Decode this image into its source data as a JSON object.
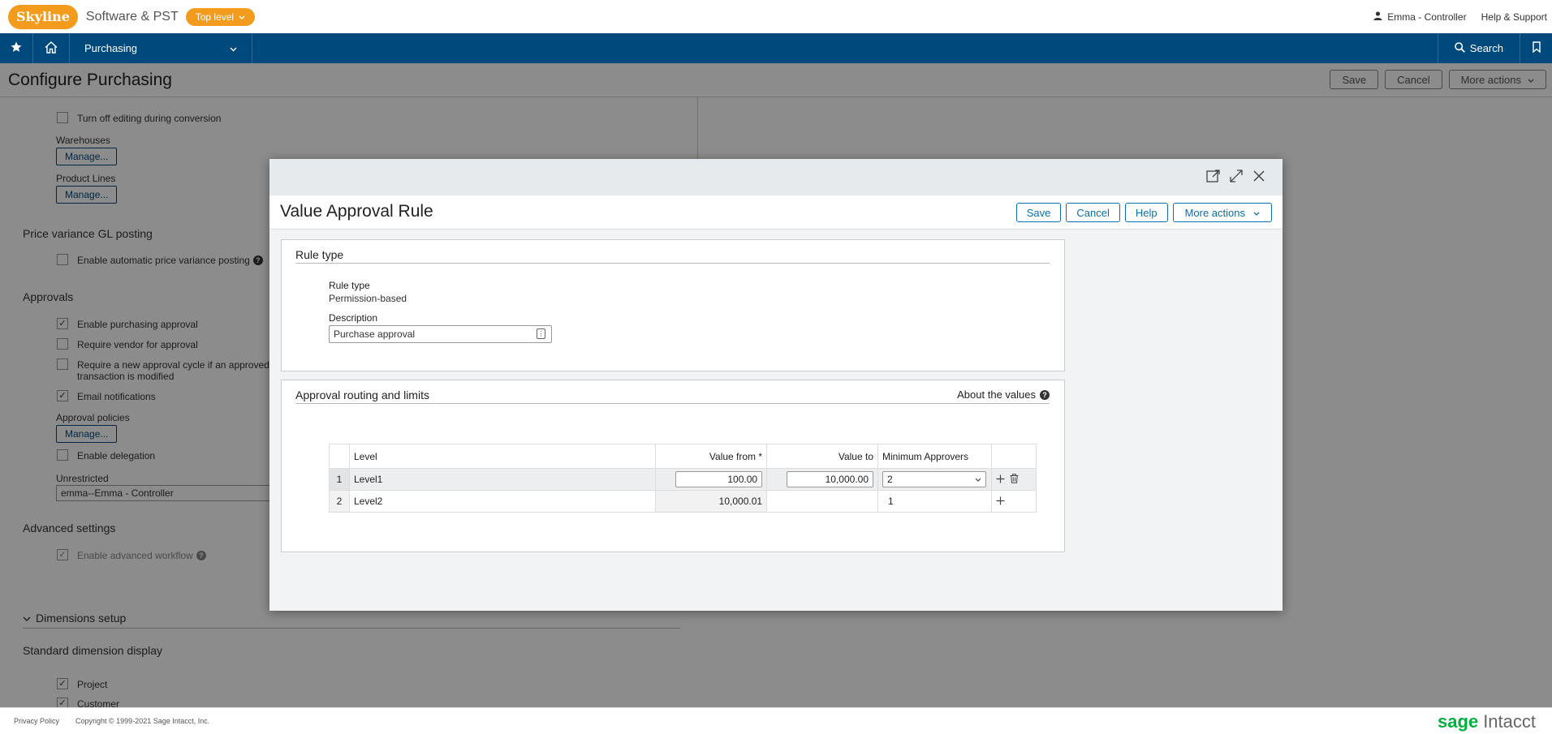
{
  "app": {
    "logo": "Skyline",
    "company": "Software & PST",
    "level": "Top level"
  },
  "topbar": {
    "user": "Emma - Controller",
    "help": "Help & Support"
  },
  "nav": {
    "module": "Purchasing",
    "search": "Search"
  },
  "page": {
    "title": "Configure Purchasing",
    "actions": {
      "save": "Save",
      "cancel": "Cancel",
      "more": "More actions"
    }
  },
  "background": {
    "turn_off_editing": "Turn off editing during conversion",
    "warehouses": "Warehouses",
    "product_lines": "Product Lines",
    "manage": "Manage...",
    "price_variance": "Price variance GL posting",
    "enable_auto_price": "Enable automatic price variance posting",
    "approvals": "Approvals",
    "enable_purchasing_approval": "Enable purchasing approval",
    "require_vendor": "Require vendor for approval",
    "require_new_cycle_1": "Require a new approval cycle if an approved",
    "require_new_cycle_2": "transaction is modified",
    "email_notifications": "Email notifications",
    "approval_policies": "Approval policies",
    "enable_delegation": "Enable delegation",
    "unrestricted": "Unrestricted",
    "unrestricted_value": "emma--Emma - Controller",
    "advanced_settings": "Advanced settings",
    "enable_advanced_workflow": "Enable advanced workflow",
    "dimensions_setup": "Dimensions setup",
    "standard_dimension_display": "Standard dimension display",
    "project": "Project",
    "customer": "Customer"
  },
  "modal": {
    "title": "Value Approval Rule",
    "actions": {
      "save": "Save",
      "cancel": "Cancel",
      "help": "Help",
      "more": "More actions"
    },
    "rule_type_section": {
      "title": "Rule type",
      "rule_type_label": "Rule type",
      "rule_type_value": "Permission-based",
      "description_label": "Description",
      "description_value": "Purchase approval"
    },
    "routing_section": {
      "title": "Approval routing and limits",
      "about": "About the values",
      "columns": [
        "Level",
        "Value from *",
        "Value to",
        "Minimum Approvers"
      ],
      "rows": [
        {
          "index": "1",
          "level": "Level1",
          "from": "100.00",
          "to": "10,000.00",
          "min": "2"
        },
        {
          "index": "2",
          "level": "Level2",
          "from": "10,000.01",
          "to": "",
          "min": "1"
        }
      ]
    }
  },
  "footer": {
    "privacy": "Privacy Policy",
    "copyright": "Copyright © 1999-2021 Sage Intacct, Inc.",
    "brand_sage": "sage",
    "brand_intacct": "Intacct"
  },
  "colors": {
    "brand_orange": "#f29b1d",
    "nav_blue": "#00497c",
    "link_blue": "#0a6eb4",
    "sage_green": "#00b140"
  }
}
